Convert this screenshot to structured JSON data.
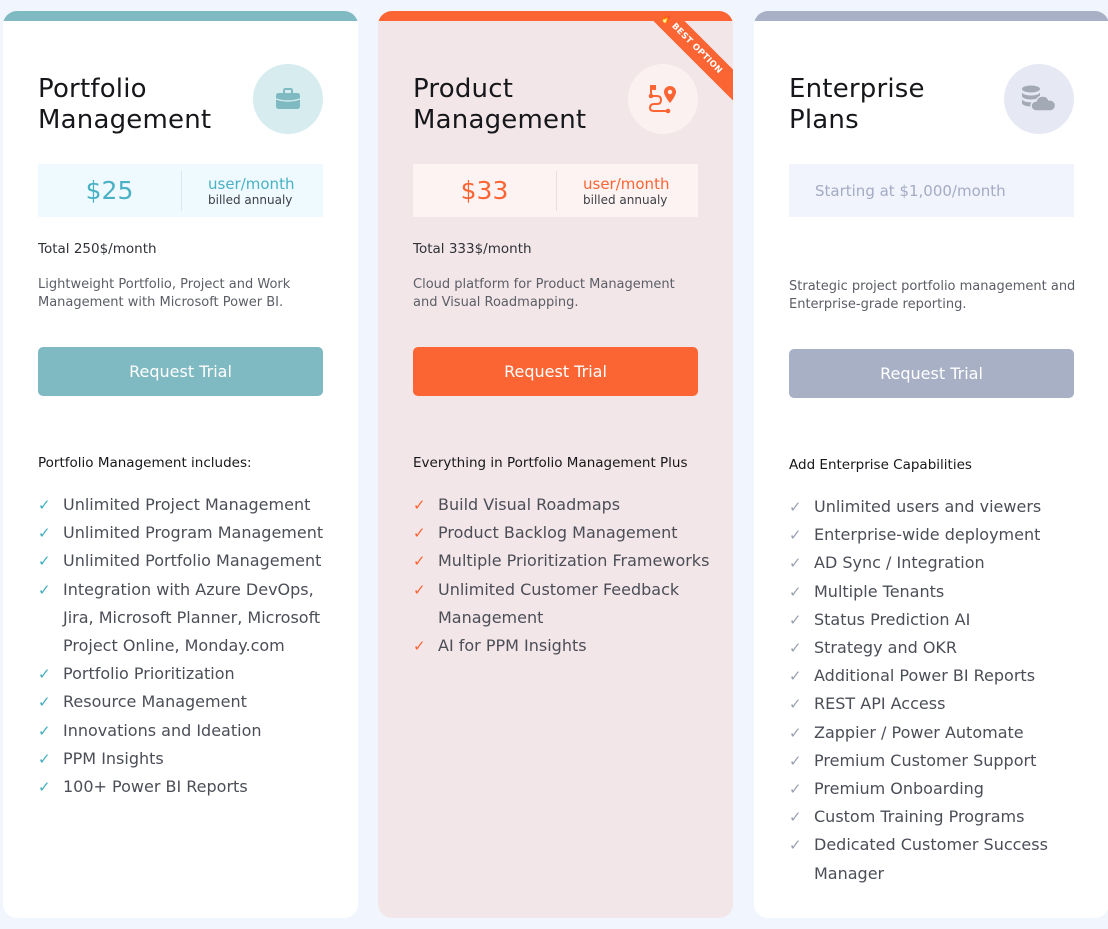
{
  "plans": [
    {
      "title_line1": "Portfolio",
      "title_line2": "Management",
      "icon": "briefcase-icon",
      "price": "$25",
      "price_unit": "user/month",
      "billing": "billed annualy",
      "total": "Total 250$/month",
      "description": "Lightweight Portfolio, Project and Work Management with Microsoft Power BI.",
      "cta": "Request Trial",
      "features_heading": "Portfolio Management includes:",
      "features": [
        "Unlimited Project Management",
        "Unlimited Program Management",
        "Unlimited Portfolio Management",
        "Integration with Azure DevOps, Jira, Microsoft Planner, Microsoft Project Online, Monday.com",
        "Portfolio Prioritization",
        "Resource Management",
        "Innovations and Ideation",
        "PPM Insights",
        "100+ Power BI Reports"
      ],
      "accent": "#7fb9c2"
    },
    {
      "title_line1": "Product",
      "title_line2": "Management",
      "icon": "roadmap-route-icon",
      "badge": "BEST OPTION",
      "price": "$33",
      "price_unit": "user/month",
      "billing": "billed annualy",
      "total": "Total 333$/month",
      "description": "Cloud platform for Product Management and Visual Roadmapping.",
      "cta": "Request Trial",
      "features_heading": "Everything in Portfolio Management Plus",
      "features": [
        "Build Visual Roadmaps",
        "Product Backlog Management",
        "Multiple Prioritization Frameworks",
        "Unlimited Customer Feedback Management",
        "AI for PPM Insights"
      ],
      "accent": "#fb6534"
    },
    {
      "title_line1": "Enterprise",
      "title_line2": "Plans",
      "icon": "database-cloud-icon",
      "starting": "Starting at $1,000/month",
      "description": "Strategic project portfolio management and Enterprise-grade reporting.",
      "cta": "Request Trial",
      "features_heading": "Add Enterprise Capabilities",
      "features": [
        "Unlimited users and viewers",
        "Enterprise-wide deployment",
        "AD Sync / Integration",
        "Multiple Tenants",
        "Status Prediction AI",
        "Strategy and OKR",
        "Additional Power BI Reports",
        "REST API Access",
        "Zappier / Power Automate",
        "Premium Customer Support",
        "Premium Onboarding",
        "Custom Training Programs",
        "Dedicated Customer Success Manager"
      ],
      "accent": "#a8b0c6"
    }
  ],
  "check_glyph": "✓",
  "flame_glyph": "🔥"
}
